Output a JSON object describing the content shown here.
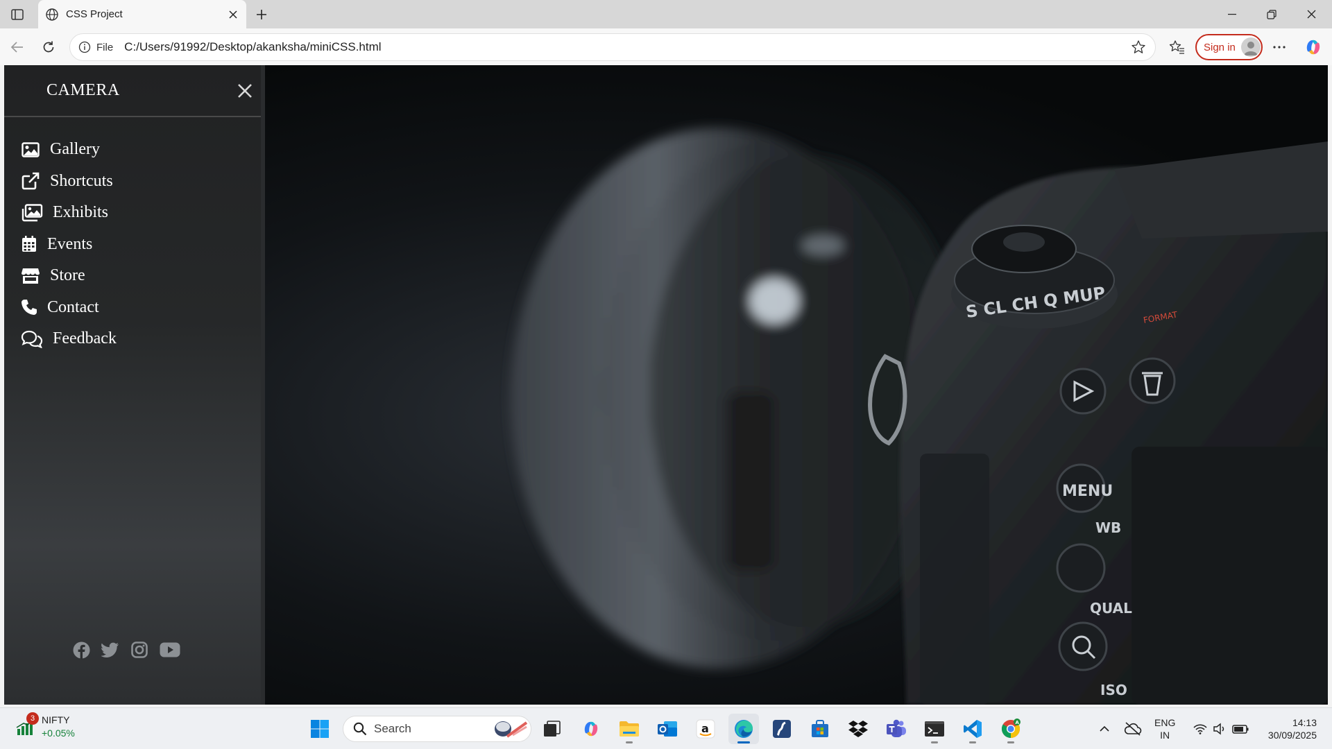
{
  "browser": {
    "tab_title": "CSS Project",
    "url_scheme_label": "File",
    "url": "C:/Users/91992/Desktop/akanksha/miniCSS.html",
    "signin_label": "Sign in"
  },
  "page": {
    "menu_title": "CAMERA",
    "menu_items": [
      {
        "label": "Gallery",
        "icon": "image-icon"
      },
      {
        "label": "Shortcuts",
        "icon": "external-link-icon"
      },
      {
        "label": "Exhibits",
        "icon": "images-icon"
      },
      {
        "label": "Events",
        "icon": "calendar-icon"
      },
      {
        "label": "Store",
        "icon": "store-icon"
      },
      {
        "label": "Contact",
        "icon": "phone-icon"
      },
      {
        "label": "Feedback",
        "icon": "comments-icon"
      }
    ],
    "socials": [
      "facebook-icon",
      "twitter-icon",
      "instagram-icon",
      "youtube-icon"
    ],
    "hero_camera_labels": {
      "mode_dial": "S CL CH Q MUP",
      "format": "FORMAT",
      "menu": "MENU",
      "wb": "WB",
      "qual": "QUAL",
      "iso": "ISO"
    }
  },
  "taskbar": {
    "widget_badge": "3",
    "widget_name": "NIFTY",
    "widget_change": "+0.05%",
    "search_placeholder": "Search",
    "lang_top": "ENG",
    "lang_bottom": "IN",
    "time": "14:13",
    "date": "30/09/2025"
  },
  "colors": {
    "menu_bg": "#232425",
    "signin_accent": "#c42b1c",
    "taskbar_bg": "#eef0f3",
    "nifty_positive": "#16823a"
  }
}
